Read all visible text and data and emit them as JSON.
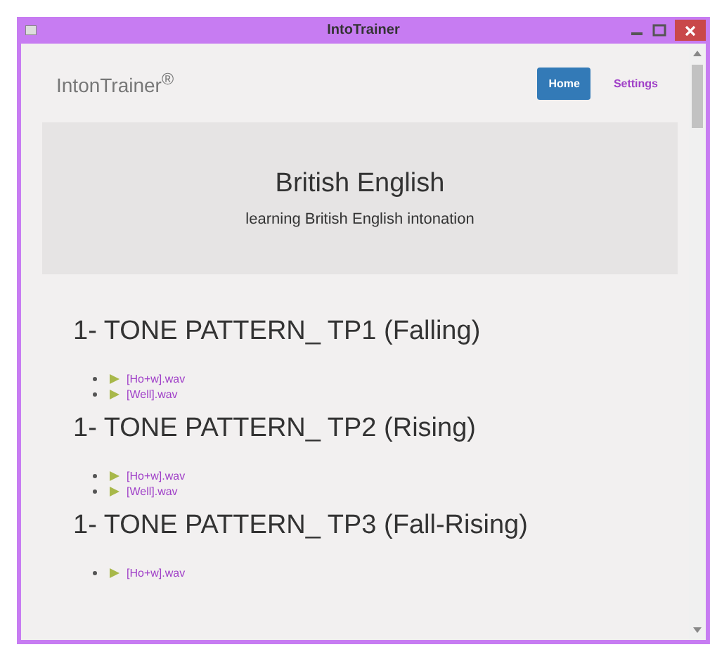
{
  "window": {
    "title": "IntoTrainer"
  },
  "navbar": {
    "brand": "IntonTrainer$^{®}$",
    "items": [
      {
        "label": "Home",
        "selected": true
      },
      {
        "label": "Settings",
        "selected": false
      }
    ]
  },
  "jumbotron": {
    "title": "British English",
    "subtitle": "learning British English intonation"
  },
  "sections": [
    {
      "heading": "1- TONE PATTERN_ TP1 (Falling)",
      "files": [
        "[Ho+w].wav",
        "[Well].wav"
      ]
    },
    {
      "heading": "1- TONE PATTERN_ TP2 (Rising)",
      "files": [
        "[Ho+w].wav",
        "[Well].wav"
      ]
    },
    {
      "heading": "1- TONE PATTERN_ TP3 (Fall-Rising)",
      "files": [
        "[Ho+w].wav"
      ]
    }
  ]
}
